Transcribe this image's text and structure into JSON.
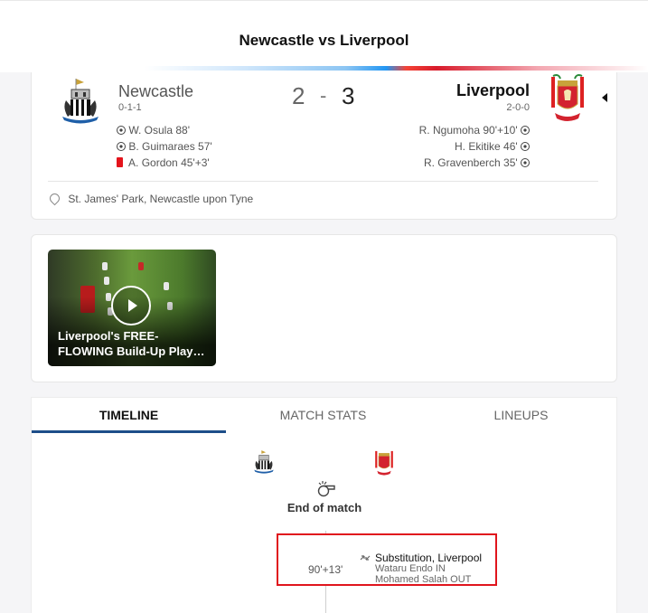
{
  "header": {
    "title": "Newcastle vs Liverpool"
  },
  "match": {
    "home": {
      "name": "Newcastle",
      "record": "0-1-1",
      "score": "2"
    },
    "away": {
      "name": "Liverpool",
      "record": "2-0-0",
      "score": "3"
    },
    "separator": "-",
    "home_events": [
      {
        "text": "W. Osula",
        "minute": "88'",
        "icon": "ball-icon"
      },
      {
        "text": "B. Guimaraes",
        "minute": "57'",
        "icon": "ball-icon"
      },
      {
        "text": "A. Gordon",
        "minute": "45'+3'",
        "icon": "red-card-icon"
      }
    ],
    "away_events": [
      {
        "text": "R. Ngumoha",
        "minute": "90'+10'",
        "icon": "ball-icon"
      },
      {
        "text": "H. Ekitike",
        "minute": "46'",
        "icon": "ball-icon"
      },
      {
        "text": "R. Gravenberch",
        "minute": "35'",
        "icon": "ball-icon"
      }
    ],
    "venue": "St. James' Park, Newcastle upon Tyne"
  },
  "video": {
    "caption": "Liverpool's FREE-FLOWING Build-Up Play…",
    "icon": "play-icon"
  },
  "tabs": [
    {
      "label": "TIMELINE",
      "active": true
    },
    {
      "label": "MATCH STATS",
      "active": false
    },
    {
      "label": "LINEUPS",
      "active": false
    }
  ],
  "timeline": {
    "end_label": "End of match",
    "event": {
      "minute": "90'+13'",
      "title": "Substitution, Liverpool",
      "in": "Wataru Endo IN",
      "out": "Mohamed Salah OUT",
      "icon": "substitution-icon"
    }
  },
  "colors": {
    "accent_blue": "#1d4e89",
    "highlight_red": "#e0151d",
    "red_card": "#e4141c"
  }
}
